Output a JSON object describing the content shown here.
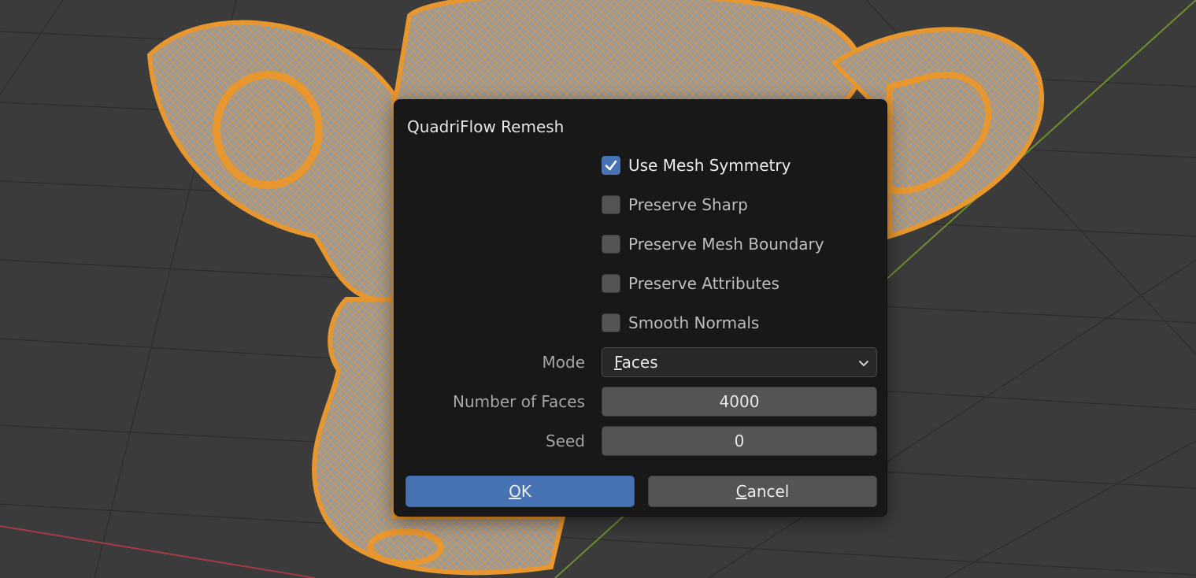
{
  "dialog": {
    "title": "QuadriFlow Remesh",
    "checkboxes": [
      {
        "label": "Use Mesh Symmetry",
        "checked": true
      },
      {
        "label": "Preserve Sharp",
        "checked": false
      },
      {
        "label": "Preserve Mesh Boundary",
        "checked": false
      },
      {
        "label": "Preserve Attributes",
        "checked": false
      },
      {
        "label": "Smooth Normals",
        "checked": false
      }
    ],
    "mode": {
      "label": "Mode",
      "value": "Faces"
    },
    "number_of_faces": {
      "label": "Number of Faces",
      "value": "4000"
    },
    "seed": {
      "label": "Seed",
      "value": "0"
    },
    "ok_label": "OK",
    "cancel_label": "Cancel"
  },
  "colors": {
    "accent": "#4772b3",
    "dialog_bg": "#181818",
    "mesh_wire": "#e8962e",
    "viewport_bg": "#3b3b3b"
  },
  "icons": {
    "check": "checkmark-icon",
    "dropdown": "chevron-down-icon"
  }
}
